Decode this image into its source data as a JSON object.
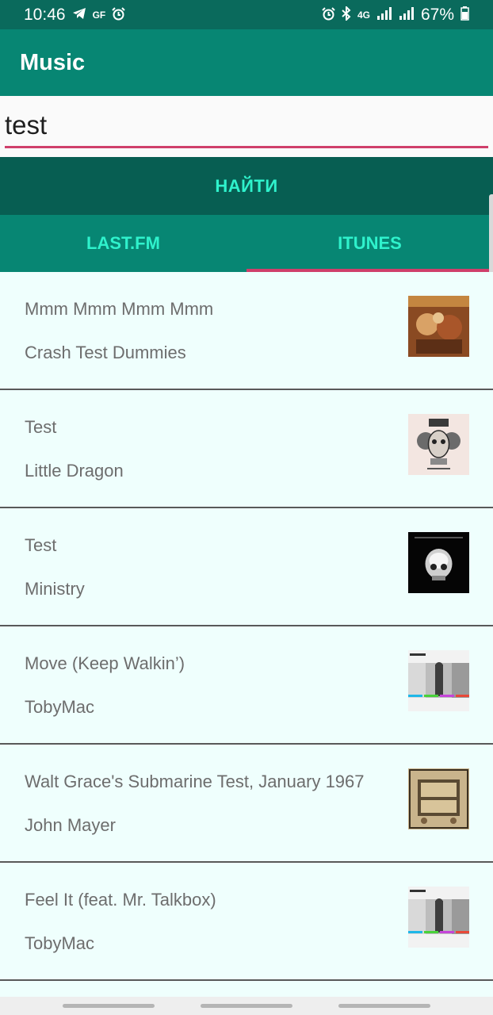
{
  "status_bar": {
    "time": "10:46",
    "left_icons": [
      "telegram-icon",
      "gf-icon",
      "alarm-icon"
    ],
    "gf_text": "GF",
    "network_label": "4G",
    "battery": "67%"
  },
  "app_bar": {
    "title": "Music"
  },
  "search": {
    "value": "test",
    "placeholder": ""
  },
  "find_button": {
    "label": "НАЙТИ"
  },
  "tabs": [
    {
      "label": "LAST.FM",
      "active": false
    },
    {
      "label": "ITUNES",
      "active": true
    }
  ],
  "colors": {
    "primary": "#078673",
    "primary_dark": "#075e52",
    "accent": "#cf3f6b",
    "tab_text": "#2ff2cc",
    "list_bg": "#effffd"
  },
  "results": [
    {
      "title": "Mmm Mmm Mmm Mmm",
      "artist": "Crash Test Dummies",
      "cover": "album-cover-icon"
    },
    {
      "title": "Test",
      "artist": "Little Dragon",
      "cover": "album-cover-icon"
    },
    {
      "title": "Test",
      "artist": "Ministry",
      "cover": "album-cover-icon"
    },
    {
      "title": "Move (Keep Walkin’)",
      "artist": "TobyMac",
      "cover": "album-cover-icon"
    },
    {
      "title": "Walt Grace's Submarine Test, January 1967",
      "artist": "John Mayer",
      "cover": "album-cover-icon"
    },
    {
      "title": "Feel It (feat. Mr. Talkbox)",
      "artist": "TobyMac",
      "cover": "album-cover-icon"
    }
  ]
}
